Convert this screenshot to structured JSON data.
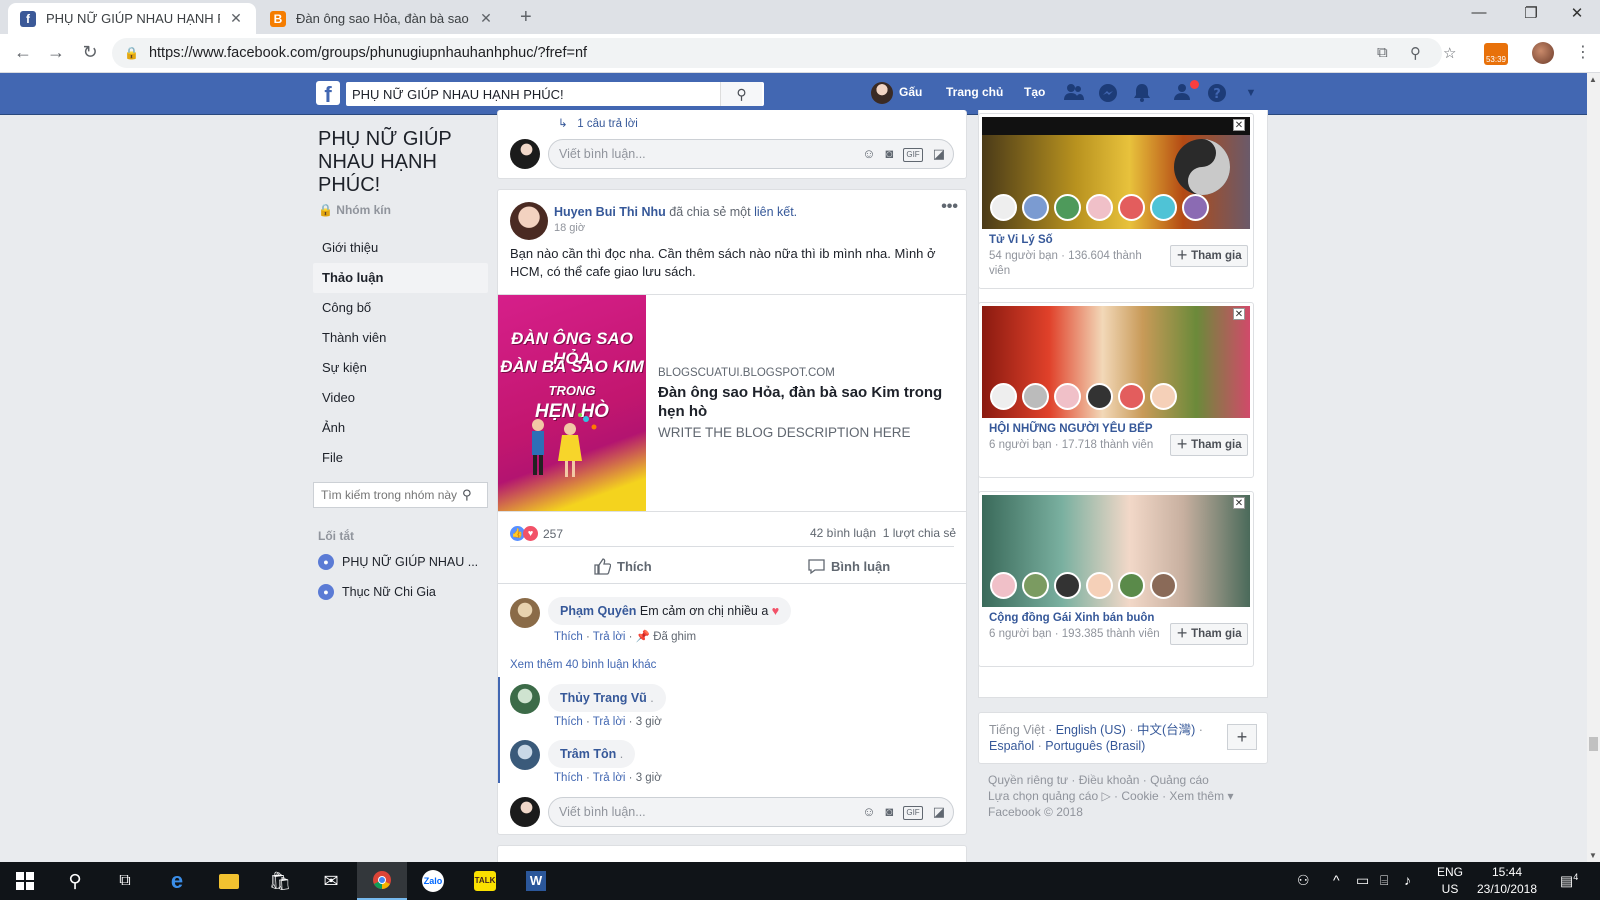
{
  "browser": {
    "tabs": [
      {
        "title": "PHỤ NỮ GIÚP NHAU HẠNH PHÚ",
        "favicon": "f",
        "favicon_color": "#3b5998"
      },
      {
        "title": "Đàn ông sao Hỏa, đàn bà sao Kim",
        "favicon": "B",
        "favicon_color": "#f57d00"
      }
    ],
    "new_tab": "+",
    "window_controls": [
      "—",
      "❐",
      "✕"
    ],
    "url": "https://www.facebook.com/groups/phunugiupnhauhanhphuc/?fref=nf",
    "extension_badge": "53:39"
  },
  "fb_header": {
    "search_value": "PHỤ NỮ GIÚP NHAU HẠNH PHÚC!",
    "user_name": "Gấu",
    "home": "Trang chủ",
    "create": "Tạo"
  },
  "group": {
    "title": "PHỤ NỮ GIÚP NHAU HẠNH PHÚC!",
    "privacy": "🔒 Nhóm kín",
    "nav": [
      "Giới thiệu",
      "Thảo luận",
      "Công bố",
      "Thành viên",
      "Sự kiện",
      "Video",
      "Ảnh",
      "File"
    ],
    "search_placeholder": "Tìm kiếm trong nhóm này",
    "shortcuts_heading": "Lối tắt",
    "shortcuts": [
      "PHỤ NỮ GIÚP NHAU ...",
      "Thục Nữ Chi Gia"
    ]
  },
  "prev_post": {
    "replies": "1 câu trả lời",
    "comment_placeholder": "Viết bình luận..."
  },
  "post": {
    "author": "Huyen Bui Thi Nhu",
    "action_pre": "đã chia sẻ một",
    "action_link": "liên kết.",
    "time": "18 giờ",
    "text": "Bạn nào cần thì đọc nha. Cần thêm sách nào nữa thì ib mình nha. Mình ở HCM, có thể cafe giao lưu sách.",
    "link": {
      "book_title_lines": [
        "ĐÀN ÔNG SAO HỎA",
        "ĐÀN BÀ SAO KIM",
        "TRONG",
        "HẸN HÒ"
      ],
      "domain": "BLOGSCUATUI.BLOGSPOT.COM",
      "title": "Đàn ông sao Hỏa, đàn bà sao Kim trong hẹn hò",
      "description": "WRITE THE BLOG DESCRIPTION HERE"
    },
    "reactions": "257",
    "comments_count": "42 bình luận",
    "shares_count": "1 lượt chia sẻ",
    "like_label": "Thích",
    "comment_label": "Bình luận",
    "comments": [
      {
        "name": "Phạm Quyên",
        "text": "Em cảm ơn chị nhiều a",
        "like": "Thích",
        "reply": "Trả lời",
        "pinned": "Đã ghim"
      }
    ],
    "more_comments": "Xem thêm 40 bình luận khác",
    "replies": [
      {
        "name": "Thủy Trang Vũ",
        "like": "Thích",
        "reply": "Trả lời",
        "time": "3 giờ"
      },
      {
        "name": "Trâm Tôn",
        "like": "Thích",
        "reply": "Trả lời",
        "time": "3 giờ"
      }
    ],
    "comment_placeholder": "Viết bình luận..."
  },
  "suggestions": [
    {
      "name": "Tử Vi Lý Số",
      "meta": "54 người bạn · 136.604 thành viên",
      "join": "Tham gia"
    },
    {
      "name": "HỘI NHỮNG NGƯỜI YÊU BẾP",
      "meta": "6 người bạn · 17.718 thành viên",
      "join": "Tham gia"
    },
    {
      "name": "Cộng đồng Gái Xinh bán buôn",
      "meta": "6 người bạn · 193.385 thành viên",
      "join": "Tham gia"
    }
  ],
  "languages": {
    "current": "Tiếng Việt",
    "others": [
      "English (US)",
      "中文(台灣)",
      "Español",
      "Português (Brasil)"
    ]
  },
  "footer": {
    "links": [
      "Quyền riêng tư",
      "Điều khoản",
      "Quảng cáo",
      "Lựa chọn quảng cáo",
      "Cookie",
      "Xem thêm"
    ],
    "copyright": "Facebook © 2018"
  },
  "taskbar": {
    "lang_top": "ENG",
    "lang_bottom": "US",
    "time": "15:44",
    "date": "23/10/2018",
    "notifications": "4"
  },
  "colors": {
    "fb_blue": "#4267b2",
    "link": "#365899"
  }
}
